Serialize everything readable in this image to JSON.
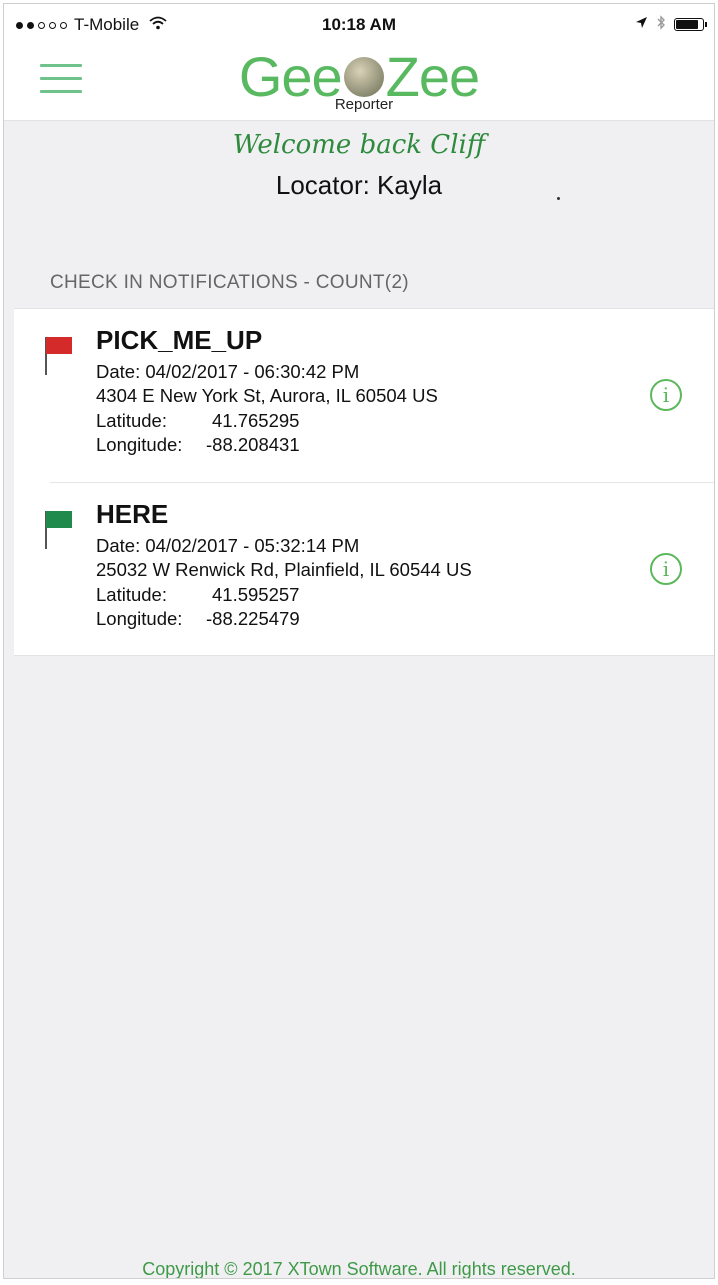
{
  "status_bar": {
    "carrier": "T-Mobile",
    "time": "10:18 AM",
    "signal_icon": "signal-dots-icon",
    "wifi_icon": "wifi-icon",
    "location_icon": "location-arrow-icon",
    "bluetooth_icon": "bluetooth-icon",
    "battery_icon": "battery-icon"
  },
  "header": {
    "menu_icon": "hamburger-icon",
    "logo_left": "Gee",
    "logo_right": "Zee",
    "logo_sub": "Reporter",
    "brand_color": "#58b960"
  },
  "welcome": "Welcome back Cliff",
  "locator": "Locator: Kayla",
  "section_label": "CHECK IN NOTIFICATIONS - COUNT(2)",
  "notifications": [
    {
      "title": "PICK_ME_UP",
      "flag_color": "#d42a2a",
      "date": "Date: 04/02/2017 - 06:30:42 PM",
      "address": "4304 E New York St, Aurora, IL 60504 US",
      "latitude_label": "Latitude:",
      "latitude": "41.765295",
      "longitude_label": "Longitude:",
      "longitude": "-88.208431"
    },
    {
      "title": "HERE",
      "flag_color": "#1f8a4c",
      "date": "Date: 04/02/2017 - 05:32:14 PM",
      "address": "25032 W Renwick Rd, Plainfield, IL 60544 US",
      "latitude_label": "Latitude:",
      "latitude": "41.595257",
      "longitude_label": "Longitude:",
      "longitude": "-88.225479"
    }
  ],
  "info_icon_glyph": "i",
  "footer": "Copyright ©  2017 XTown Software. All rights reserved."
}
